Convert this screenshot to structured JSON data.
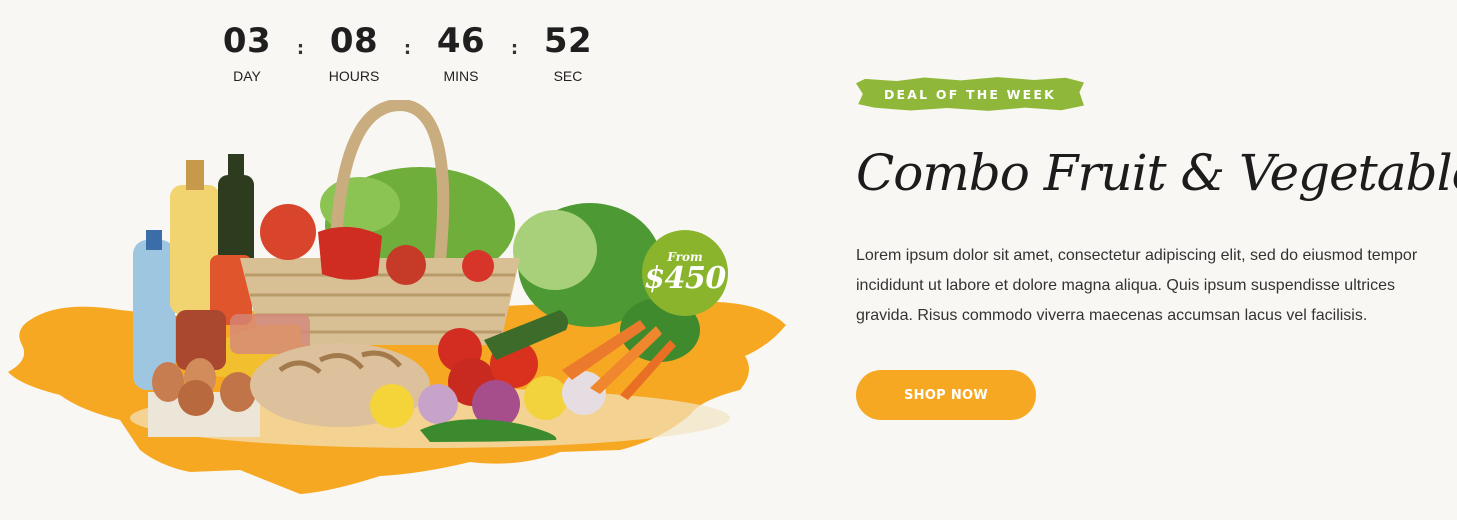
{
  "countdown": {
    "units": [
      {
        "value": "03",
        "label": "DAY"
      },
      {
        "value": "08",
        "label": "HOURS"
      },
      {
        "value": "46",
        "label": "MINS"
      },
      {
        "value": "52",
        "label": "SEC"
      }
    ],
    "separator": ":"
  },
  "price_badge": {
    "from_text": "From",
    "amount": "$450"
  },
  "deal": {
    "tag": "DEAL OF THE WEEK",
    "title": "Combo Fruit & Vegetables",
    "description": "Lorem ipsum dolor sit amet, consectetur adipiscing elit, sed do eiusmod tempor incididunt ut labore et dolore magna aliqua. Quis ipsum suspendisse ultrices gravida. Risus commodo viverra maecenas accumsan lacus vel facilisis.",
    "button_label": "SHOP NOW"
  },
  "colors": {
    "accent_orange": "#f7a823",
    "accent_green": "#8fb83a",
    "background": "#f9f7f3"
  }
}
